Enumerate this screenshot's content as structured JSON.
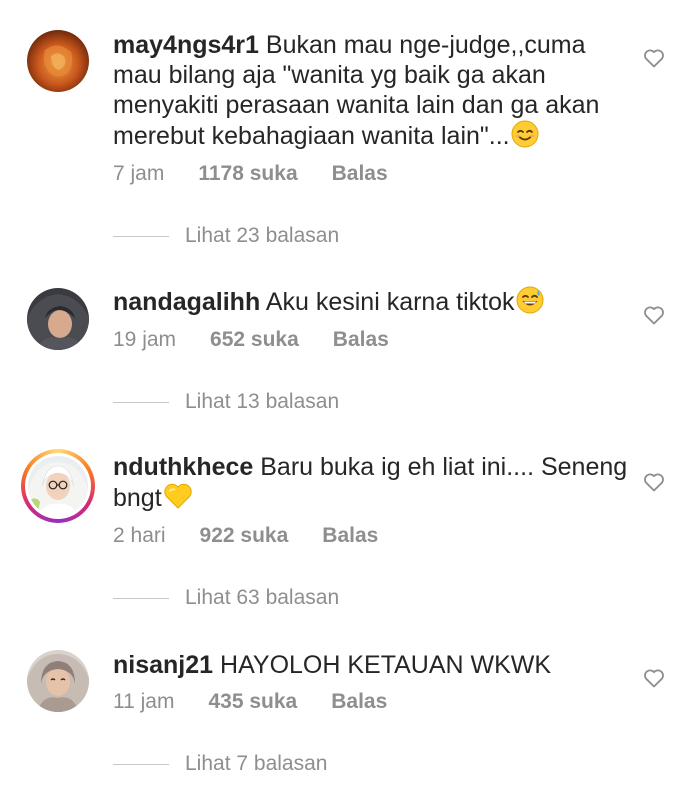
{
  "comments": [
    {
      "username": "may4ngs4r1",
      "text": "Bukan mau nge-judge,,cuma mau bilang aja \"wanita yg baik ga akan menyakiti perasaan wanita lain dan ga akan merebut kebahagiaan wanita lain\"...",
      "emoji": "smiling-face-icon",
      "time": "7 jam",
      "likes": "1178 suka",
      "reply_label": "Balas",
      "view_replies": "Lihat 23 balasan"
    },
    {
      "username": "nandagalihh",
      "text": "Aku kesini karna tiktok",
      "emoji": "grinning-sweat-face-icon",
      "time": "19 jam",
      "likes": "652 suka",
      "reply_label": "Balas",
      "view_replies": "Lihat 13 balasan"
    },
    {
      "username": "nduthkhece",
      "text": "Baru buka ig eh liat ini.... Seneng bngt",
      "emoji": "yellow-heart-icon",
      "time": "2 hari",
      "likes": "922 suka",
      "reply_label": "Balas",
      "view_replies": "Lihat 63 balasan"
    },
    {
      "username": "nisanj21",
      "text": "HAYOLOH KETAUAN WKWK",
      "emoji": "",
      "time": "11 jam",
      "likes": "435 suka",
      "reply_label": "Balas",
      "view_replies": "Lihat 7 balasan"
    }
  ],
  "colors": {
    "text": "#262626",
    "meta": "#8e8e8e",
    "divider": "#c7c7c7",
    "story_ring": [
      "#feda75",
      "#fa7e1e",
      "#d62976",
      "#962fbf"
    ]
  }
}
